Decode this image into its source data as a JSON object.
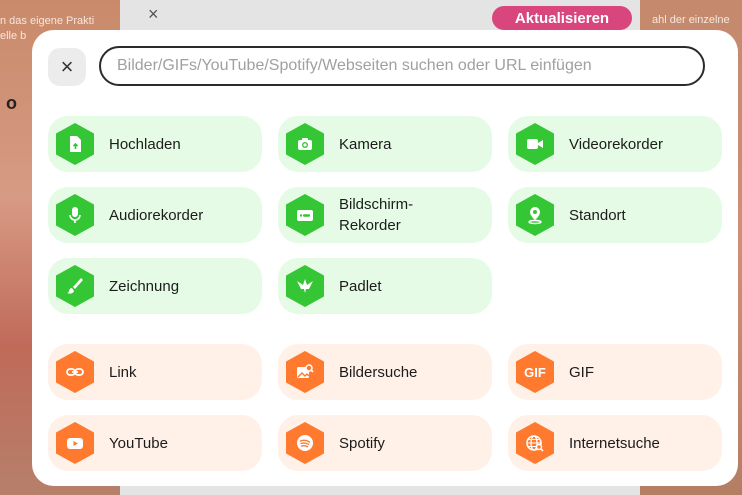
{
  "background": {
    "left_text": "n das eigene Prakti\nelle b",
    "left_heading": "o",
    "right_text": "ahl der einzelne",
    "update_button": "Aktualisieren"
  },
  "modal": {
    "search_placeholder": "Bilder/GIFs/YouTube/Spotify/Webseiten suchen oder URL einfügen",
    "close_icon": "×",
    "green_items": [
      {
        "label": "Hochladen",
        "icon": "upload-file-icon"
      },
      {
        "label": "Kamera",
        "icon": "camera-icon"
      },
      {
        "label": "Videorekorder",
        "icon": "video-camera-icon"
      },
      {
        "label": "Audiorekorder",
        "icon": "microphone-icon"
      },
      {
        "label": "Bildschirm-\nRekorder",
        "icon": "screen-recorder-icon"
      },
      {
        "label": "Standort",
        "icon": "location-pin-icon"
      },
      {
        "label": "Zeichnung",
        "icon": "brush-icon"
      },
      {
        "label": "Padlet",
        "icon": "padlet-bird-icon"
      }
    ],
    "orange_items": [
      {
        "label": "Link",
        "icon": "link-icon"
      },
      {
        "label": "Bildersuche",
        "icon": "image-search-icon"
      },
      {
        "label": "GIF",
        "icon": "gif-icon",
        "icon_text": "GIF"
      },
      {
        "label": "YouTube",
        "icon": "youtube-icon"
      },
      {
        "label": "Spotify",
        "icon": "spotify-icon"
      },
      {
        "label": "Internetsuche",
        "icon": "globe-search-icon"
      }
    ]
  },
  "colors": {
    "green_bg": "#e5fbe5",
    "green_icon": "#35c635",
    "orange_bg": "#fff1e8",
    "orange_icon": "#ff7a2e",
    "update_button": "#d8467d"
  }
}
